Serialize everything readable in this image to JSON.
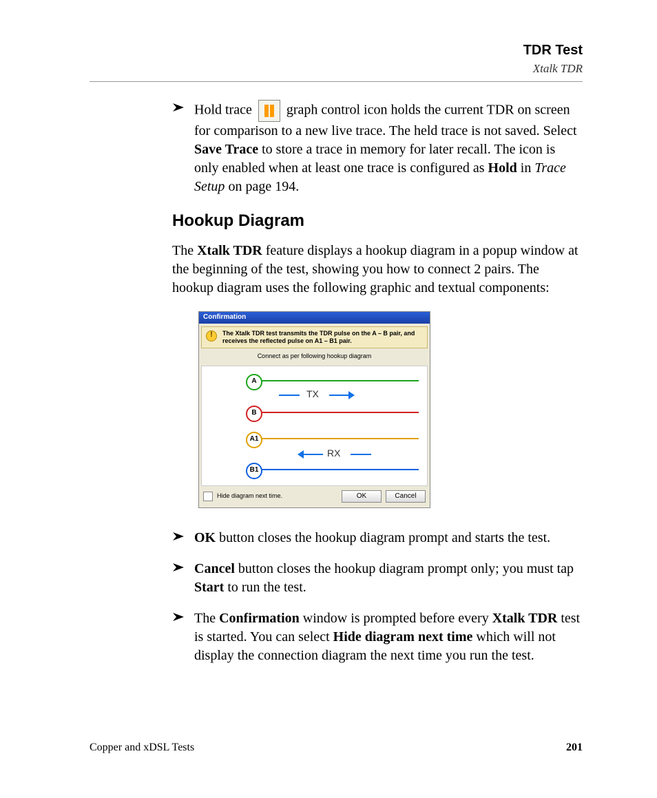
{
  "header": {
    "title": "TDR Test",
    "subtitle": "Xtalk TDR"
  },
  "hold_trace_bullet": {
    "p1a": "Hold trace ",
    "p1b": " graph control icon holds the current TDR on screen for comparison to a new live trace. The held trace is not saved. Select ",
    "save_trace_bold": "Save Trace",
    "p1c": " to store a trace in memory for later recall. The icon is only enabled when at least one trace is configured as ",
    "hold_bold": "Hold",
    "p1d": " in ",
    "trace_setup_ital": "Trace Setup",
    "p1e": " on page 194."
  },
  "section_title": "Hookup Diagram",
  "intro_para": {
    "a": "The ",
    "xtalk_bold": "Xtalk TDR",
    "b": " feature displays a hookup diagram in a popup window at the beginning of the test, showing you how to connect 2 pairs. The hookup diagram uses the following graphic and textual components:"
  },
  "dialog": {
    "title": "Confirmation",
    "warn_text": "The Xtalk TDR test transmits the TDR pulse on the A – B pair, and receives the reflected pulse on A1 – B1 pair.",
    "caption": "Connect as per following hookup diagram",
    "pins": {
      "a": "A",
      "b": "B",
      "a1": "A1",
      "b1": "B1"
    },
    "tx": "TX",
    "rx": "RX",
    "hide_label": "Hide diagram next time.",
    "ok": "OK",
    "cancel": "Cancel"
  },
  "bullets": {
    "ok": {
      "bold": "OK",
      "rest": " button closes the hookup diagram prompt and starts the test."
    },
    "cancel": {
      "bold": "Cancel",
      "a": " button closes the hookup diagram prompt only; you must tap ",
      "start_bold": "Start",
      "b": " to run the test."
    },
    "confirm": {
      "a": "The ",
      "conf_bold": "Confirmation",
      "b": " window is prompted before every ",
      "xtalk_bold": "Xtalk TDR",
      "c": " test is started. You can select ",
      "hide_bold": "Hide diagram next time",
      "d": " which will not display the connection diagram the next time you run the test."
    }
  },
  "footer": {
    "left": "Copper and xDSL Tests",
    "page": "201"
  }
}
